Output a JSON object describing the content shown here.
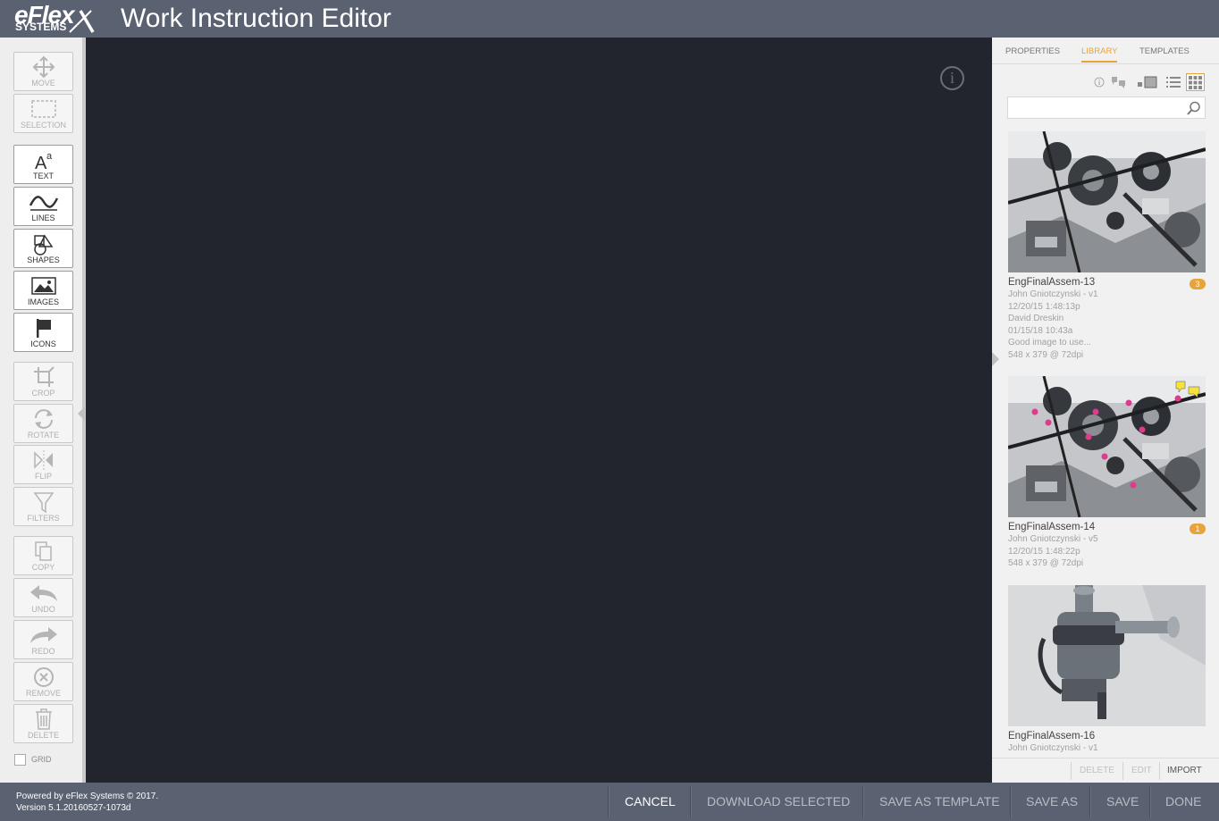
{
  "header": {
    "logo_line1": "eFlex",
    "logo_line2": "SYSTEMS",
    "title": "Work Instruction Editor"
  },
  "toolbar": {
    "tools": [
      {
        "id": "move",
        "label": "MOVE",
        "icon": "move-icon"
      },
      {
        "id": "selection",
        "label": "SELECTION",
        "icon": "selection-icon"
      },
      {
        "id": "text",
        "label": "TEXT",
        "icon": "text-icon"
      },
      {
        "id": "lines",
        "label": "LINES",
        "icon": "lines-icon"
      },
      {
        "id": "shapes",
        "label": "SHAPES",
        "icon": "shapes-icon"
      },
      {
        "id": "images",
        "label": "IMAGES",
        "icon": "images-icon"
      },
      {
        "id": "icons",
        "label": "ICONS",
        "icon": "flag-icon"
      },
      {
        "id": "crop",
        "label": "CROP",
        "icon": "crop-icon"
      },
      {
        "id": "rotate",
        "label": "ROTATE",
        "icon": "rotate-icon"
      },
      {
        "id": "flip",
        "label": "FLIP",
        "icon": "flip-icon"
      },
      {
        "id": "filters",
        "label": "FILTERS",
        "icon": "filter-icon"
      },
      {
        "id": "copy",
        "label": "COPY",
        "icon": "copy-icon"
      },
      {
        "id": "undo",
        "label": "UNDO",
        "icon": "undo-icon"
      },
      {
        "id": "redo",
        "label": "REDO",
        "icon": "redo-icon"
      },
      {
        "id": "remove",
        "label": "REMOVE",
        "icon": "remove-icon"
      },
      {
        "id": "delete",
        "label": "DELETE",
        "icon": "trash-icon"
      }
    ],
    "grid_label": "GRID"
  },
  "canvas": {
    "info_icon": "info-icon",
    "info_glyph": "i"
  },
  "panel": {
    "tabs": [
      {
        "label": "PROPERTIES",
        "active": false
      },
      {
        "label": "LIBRARY",
        "active": true
      },
      {
        "label": "TEMPLATES",
        "active": false
      }
    ],
    "search": {
      "value": "",
      "placeholder": ""
    },
    "items": [
      {
        "name": "EngFinalAssem-13",
        "badge": "3",
        "meta": [
          "John Gniotczynski - v1",
          "12/20/15 1:48:13p",
          "David Dreskin",
          "01/15/18 10:43a",
          "Good image to use...",
          "548 x 379 @ 72dpi"
        ]
      },
      {
        "name": "EngFinalAssem-14",
        "badge": "1",
        "meta": [
          "John Gniotczynski - v5",
          "12/20/15 1:48:22p",
          "548 x 379 @ 72dpi"
        ]
      },
      {
        "name": "EngFinalAssem-16",
        "badge": "",
        "meta": [
          "John Gniotczynski - v1"
        ]
      }
    ],
    "footer": {
      "delete": "DELETE",
      "edit": "EDIT",
      "import": "IMPORT"
    }
  },
  "footer": {
    "powered": "Powered by eFlex Systems © 2017.",
    "version": "Version 5.1.20160527-1073d",
    "cancel": "CANCEL",
    "download_selected": "DOWNLOAD SELECTED",
    "save_as_template": "SAVE AS TEMPLATE",
    "save_as": "SAVE AS",
    "save": "SAVE",
    "done": "DONE"
  },
  "colors": {
    "header_bg": "#5a6170",
    "canvas_bg": "#22252e",
    "accent": "#e8a33a",
    "panel_bg": "#f1f1f1"
  }
}
